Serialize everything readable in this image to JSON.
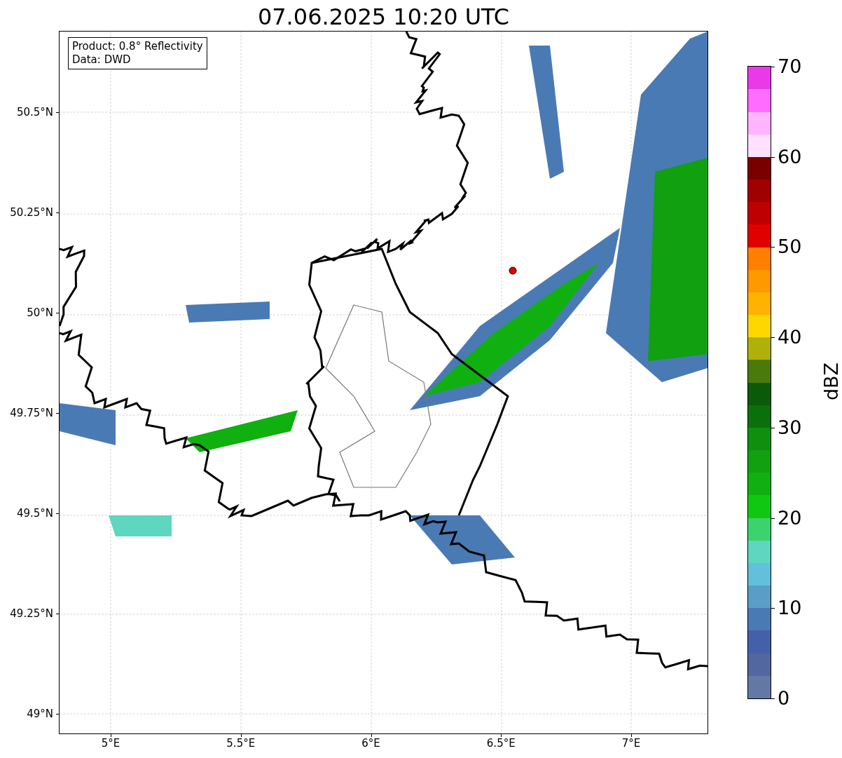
{
  "title": "07.06.2025 10:20 UTC",
  "info_box": [
    "Product: 0.8° Reflectivity",
    "Data: DWD"
  ],
  "map": {
    "y_ticks": [
      "50.5°N",
      "50.25°N",
      "50°N",
      "49.75°N",
      "49.5°N",
      "49.25°N",
      "49°N"
    ],
    "x_ticks": [
      "5°E",
      "5.5°E",
      "6°E",
      "6.5°E",
      "7°E"
    ]
  },
  "colorbar": {
    "label": "dBZ",
    "ticks": [
      "70",
      "60",
      "50",
      "40",
      "30",
      "20",
      "10",
      "0"
    ],
    "bins": [
      {
        "color": "#6478a8"
      },
      {
        "color": "#5266a0"
      },
      {
        "color": "#4460a8"
      },
      {
        "color": "#4a7ab4"
      },
      {
        "color": "#5a9ec8"
      },
      {
        "color": "#62c0dc"
      },
      {
        "color": "#5fd6c0"
      },
      {
        "color": "#3cd26e"
      },
      {
        "color": "#10c810"
      },
      {
        "color": "#10b010"
      },
      {
        "color": "#10a010"
      },
      {
        "color": "#0e900e"
      },
      {
        "color": "#0a700a"
      },
      {
        "color": "#0a5a0a"
      },
      {
        "color": "#4a7a0a"
      },
      {
        "color": "#b0b00a"
      },
      {
        "color": "#ffd700"
      },
      {
        "color": "#ffb300"
      },
      {
        "color": "#ff9900"
      },
      {
        "color": "#ff7f00"
      },
      {
        "color": "#e00000"
      },
      {
        "color": "#c00000"
      },
      {
        "color": "#a00000"
      },
      {
        "color": "#7a0000"
      },
      {
        "color": "#ffe0ff"
      },
      {
        "color": "#ffb4ff"
      },
      {
        "color": "#ff6cff"
      },
      {
        "color": "#e83ae8"
      }
    ]
  }
}
